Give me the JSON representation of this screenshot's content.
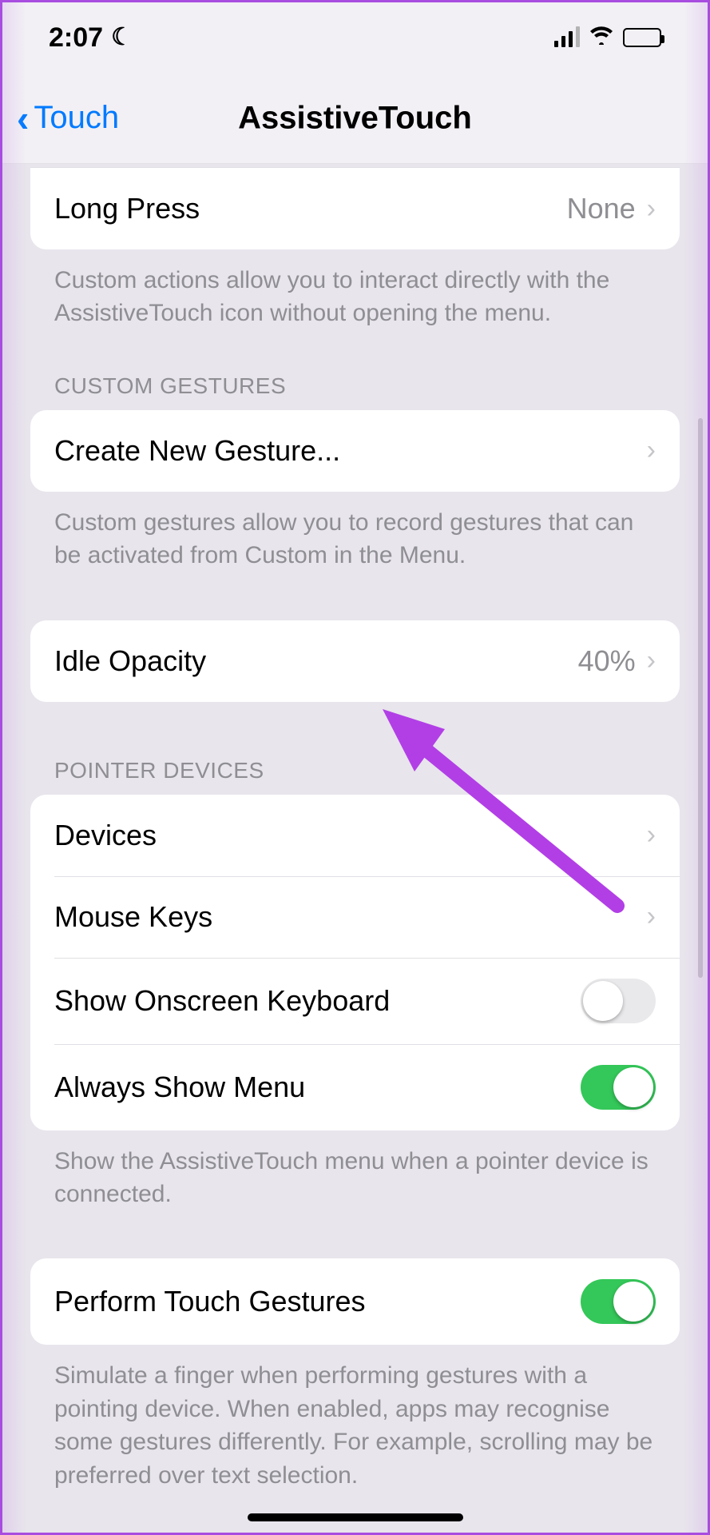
{
  "status": {
    "time": "2:07"
  },
  "nav": {
    "back_label": "Touch",
    "title": "AssistiveTouch"
  },
  "custom_actions": {
    "long_press": {
      "label": "Long Press",
      "value": "None"
    },
    "footer": "Custom actions allow you to interact directly with the AssistiveTouch icon without opening the menu."
  },
  "custom_gestures": {
    "header": "CUSTOM GESTURES",
    "create": {
      "label": "Create New Gesture..."
    },
    "footer": "Custom gestures allow you to record gestures that can be activated from Custom in the Menu."
  },
  "idle_opacity": {
    "label": "Idle Opacity",
    "value": "40%"
  },
  "pointer_devices": {
    "header": "POINTER DEVICES",
    "devices": {
      "label": "Devices"
    },
    "mouse_keys": {
      "label": "Mouse Keys"
    },
    "show_keyboard": {
      "label": "Show Onscreen Keyboard",
      "on": false
    },
    "always_show_menu": {
      "label": "Always Show Menu",
      "on": true
    },
    "footer": "Show the AssistiveTouch menu when a pointer device is connected."
  },
  "touch_gestures": {
    "perform": {
      "label": "Perform Touch Gestures",
      "on": true
    },
    "footer": "Simulate a finger when performing gestures with a pointing device. When enabled, apps may recognise some gestures differently. For example, scrolling may be preferred over text selection."
  }
}
